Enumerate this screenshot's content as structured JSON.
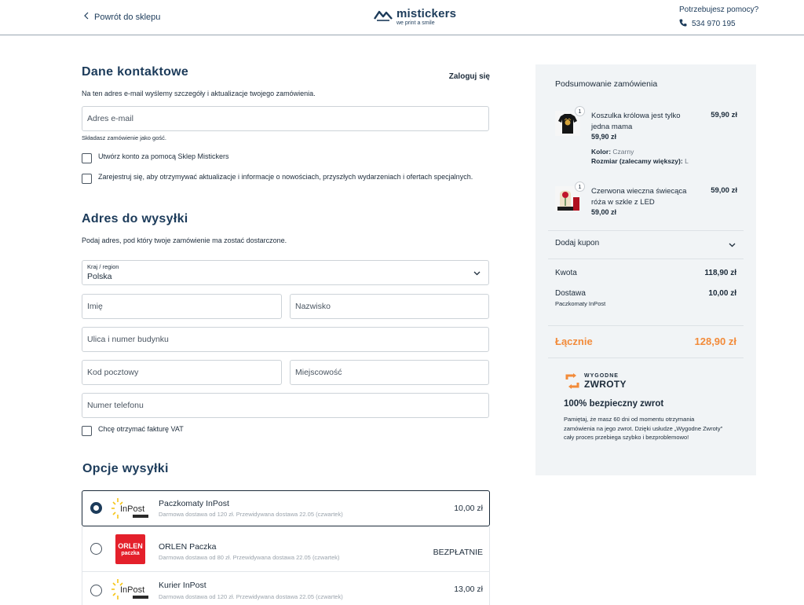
{
  "header": {
    "back_label": "Powrót do sklepu",
    "logo_name": "mistickers",
    "logo_tagline": "we print a smile",
    "help_title": "Potrzebujesz pomocy?",
    "help_phone": "534 970 195"
  },
  "contact": {
    "title": "Dane kontaktowe",
    "login_label": "Zaloguj się",
    "description": "Na ten adres e-mail wyślemy szczegóły i aktualizacje twojego zamówienia.",
    "email_placeholder": "Adres e-mail",
    "guest_hint": "Składasz zamówienie jako gość.",
    "create_account_label": "Utwórz konto za pomocą Sklep Mistickers",
    "newsletter_label": "Zarejestruj się, aby otrzymywać aktualizacje i informacje o nowościach, przyszłych wydarzeniach i ofertach specjalnych."
  },
  "shipping_address": {
    "title": "Adres do wysyłki",
    "description": "Podaj adres, pod który twoje zamówienie ma zostać dostarczone.",
    "country_label": "Kraj / region",
    "country_value": "Polska",
    "first_name_placeholder": "Imię",
    "last_name_placeholder": "Nazwisko",
    "street_placeholder": "Ulica i numer budynku",
    "postcode_placeholder": "Kod pocztowy",
    "city_placeholder": "Miejscowość",
    "phone_placeholder": "Numer telefonu",
    "invoice_label": "Chcę otrzymać fakturę VAT"
  },
  "shipping_options": {
    "title": "Opcje wysyłki",
    "options": [
      {
        "name": "Paczkomaty InPost",
        "desc": "Darmowa dostawa od 120 zł. Przewidywana dostawa 22.05 (czwartek)",
        "price": "10,00 zł",
        "logo_text": "InPost",
        "selected": true
      },
      {
        "name": "ORLEN Paczka",
        "desc": "Darmowa dostawa od 80 zł. Przewidywana dostawa 22.05 (czwartek)",
        "price": "BEZPŁATNIE",
        "logo_text_top": "ORLEN",
        "logo_text_bottom": "paczka",
        "selected": false
      },
      {
        "name": "Kurier InPost",
        "desc": "Darmowa dostawa od 120 zł. Przewidywana dostawa 22.05 (czwartek)",
        "price": "13,00 zł",
        "logo_text": "InPost",
        "selected": false
      }
    ]
  },
  "summary": {
    "title": "Podsumowanie zamówienia",
    "items": [
      {
        "qty": "1",
        "name": "Koszulka królowa jest tylko jedna mama",
        "price": "59,90 zł",
        "unit_price": "59,90 zł",
        "attr1_label": "Kolor:",
        "attr1_value": "Czarny",
        "attr2_label": "Rozmiar (zalecamy większy):",
        "attr2_value": "L"
      },
      {
        "qty": "1",
        "name": "Czerwona wieczna świecąca róża w szkle z LED",
        "price": "59,00 zł",
        "unit_price": "59,00 zł"
      }
    ],
    "coupon_label": "Dodaj kupon",
    "subtotal_label": "Kwota",
    "subtotal_value": "118,90 zł",
    "shipping_label": "Dostawa",
    "shipping_value": "10,00 zł",
    "shipping_method": "Paczkomaty InPost",
    "total_label": "Łącznie",
    "total_value": "128,90 zł",
    "returns_logo_top": "WYGODNE",
    "returns_logo_bottom": "ZWROTY",
    "returns_title": "100% bezpieczny zwrot",
    "returns_text": "Pamiętaj, że masz 60 dni od momentu otrzymania zamówienia na jego zwrot. Dzięki usłudze „Wygodne Zwroty\" cały proces przebiega szybko i bezproblemowo!"
  },
  "colors": {
    "navy": "#1c3b5a",
    "accent_orange": "#f28b3a",
    "summary_bg": "#f1f4f6"
  }
}
